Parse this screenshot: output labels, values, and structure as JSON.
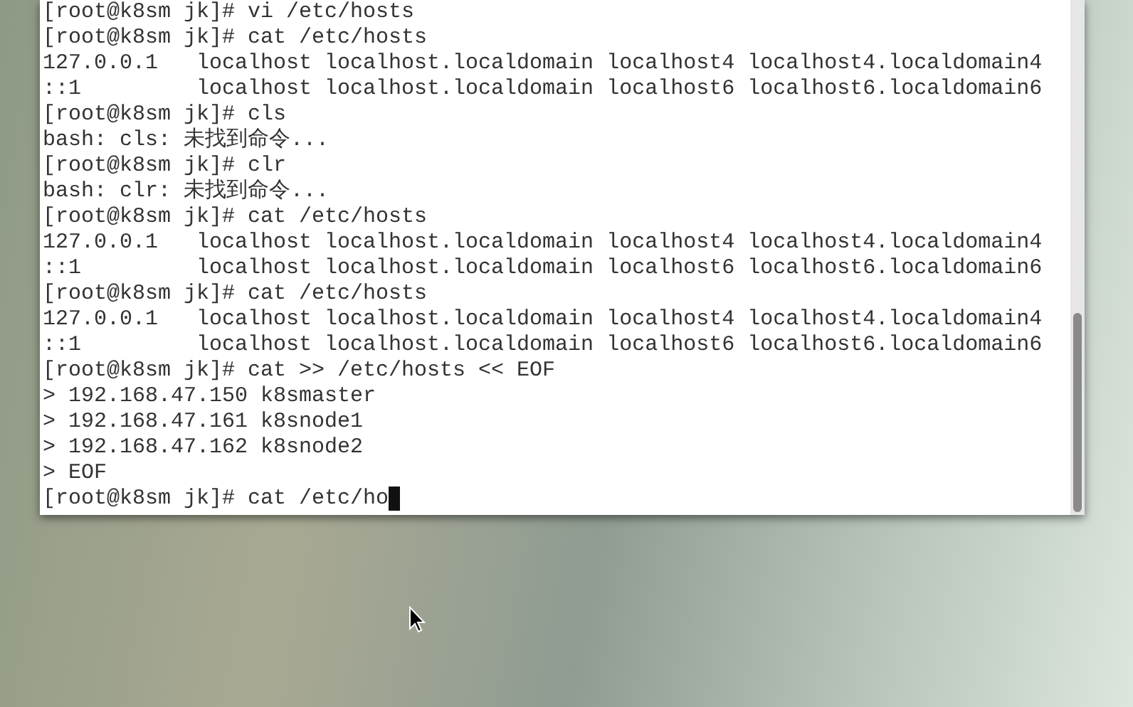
{
  "terminal": {
    "lines": [
      "[root@k8sm jk]# vi /etc/hosts",
      "[root@k8sm jk]# cat /etc/hosts",
      "127.0.0.1   localhost localhost.localdomain localhost4 localhost4.localdomain4",
      "::1         localhost localhost.localdomain localhost6 localhost6.localdomain6",
      "[root@k8sm jk]# cls",
      "bash: cls: 未找到命令...",
      "[root@k8sm jk]# clr",
      "bash: clr: 未找到命令...",
      "[root@k8sm jk]# cat /etc/hosts",
      "127.0.0.1   localhost localhost.localdomain localhost4 localhost4.localdomain4",
      "::1         localhost localhost.localdomain localhost6 localhost6.localdomain6",
      "[root@k8sm jk]# cat /etc/hosts",
      "127.0.0.1   localhost localhost.localdomain localhost4 localhost4.localdomain4",
      "::1         localhost localhost.localdomain localhost6 localhost6.localdomain6",
      "[root@k8sm jk]# cat >> /etc/hosts << EOF",
      "> 192.168.47.150 k8smaster",
      "> 192.168.47.161 k8snode1",
      "> 192.168.47.162 k8snode2",
      "> EOF"
    ],
    "input_line": "[root@k8sm jk]# cat /etc/ho"
  }
}
